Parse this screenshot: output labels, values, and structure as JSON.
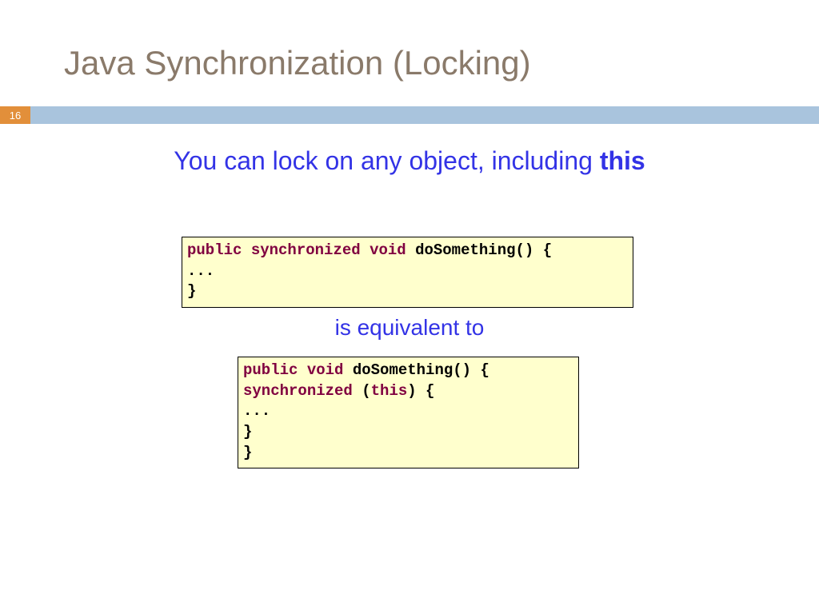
{
  "title": "Java Synchronization (Locking)",
  "pageNumber": "16",
  "subtitle_pre": "You can lock on any object, including ",
  "subtitle_bold": "this",
  "equiv": "is equivalent to",
  "code1": {
    "l1_k1": "public",
    "l1_k2": "synchronized",
    "l1_k3": "void",
    "l1_rest": " doSomething() {",
    "l2": "   ...",
    "l3": "}"
  },
  "code2": {
    "l1_k1": "public",
    "l1_k2": "void",
    "l1_rest": " doSomething() {",
    "l2_indent": "    ",
    "l2_kw": "synchronized",
    "l2_paren_open": " (",
    "l2_this": "this",
    "l2_paren_close": ") {",
    "l3": "       ...",
    "l4": "    }",
    "l5": "}"
  }
}
